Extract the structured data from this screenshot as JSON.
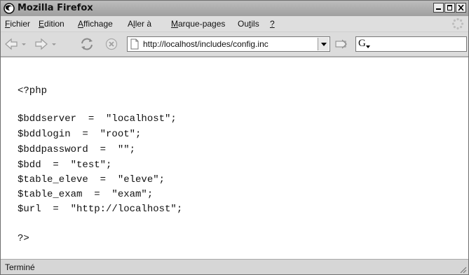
{
  "window": {
    "title": "Mozilla Firefox"
  },
  "menu": {
    "items": [
      {
        "label_pre": "",
        "label_u": "F",
        "label_post": "ichier"
      },
      {
        "label_pre": "",
        "label_u": "E",
        "label_post": "dition"
      },
      {
        "label_pre": "",
        "label_u": "A",
        "label_post": "ffichage"
      },
      {
        "label_pre": "A",
        "label_u": "l",
        "label_post": "ler à"
      },
      {
        "label_pre": "",
        "label_u": "M",
        "label_post": "arque-pages"
      },
      {
        "label_pre": "Ou",
        "label_u": "t",
        "label_post": "ils"
      },
      {
        "label_pre": "",
        "label_u": "?",
        "label_post": ""
      }
    ]
  },
  "navbar": {
    "url": "http://localhost/includes/config.inc",
    "search_engine": "G"
  },
  "content": {
    "lines": [
      "<?php",
      "",
      "$bddserver  =  \"localhost\";",
      "$bddlogin  =  \"root\";",
      "$bddpassword  =  \"\";",
      "$bdd  =  \"test\";",
      "$table_eleve  =  \"eleve\";",
      "$table_exam  =  \"exam\";",
      "$url  =  \"http://localhost\";",
      "",
      "?>"
    ]
  },
  "status": {
    "text": "Terminé"
  }
}
